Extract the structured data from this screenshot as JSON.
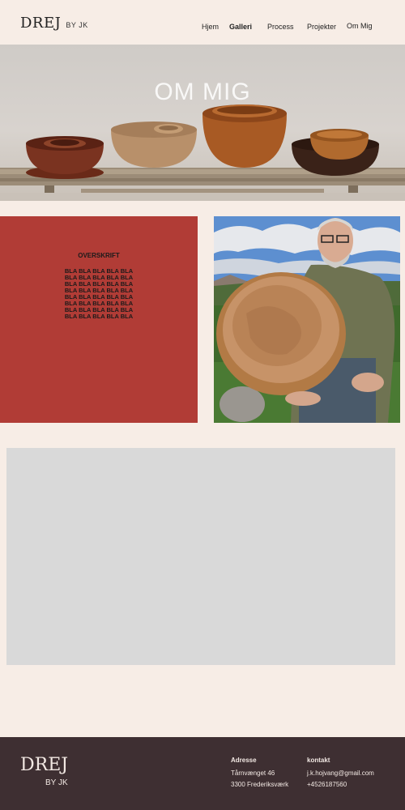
{
  "header": {
    "logo_main": "DREJ",
    "logo_sub": "BY JK",
    "nav": [
      {
        "label": "Hjem"
      },
      {
        "label": "Galleri"
      },
      {
        "label": "Process"
      },
      {
        "label": "Projekter"
      },
      {
        "label": "Om Mig"
      }
    ]
  },
  "hero": {
    "title": "OM MIG"
  },
  "textblock": {
    "heading": "OVERSKRIFT",
    "lines": [
      "BLA BLA BLA BLA BLA",
      "BLA BLA BLA BLA BLA",
      "BLA BLA BLA BLA BLA",
      "BLA BLA BLA BLA BLA",
      "BLA BLA BLA BLA BLA",
      "BLA BLA BLA BLA BLA",
      "BLA BLA BLA BLA BLA",
      "BLA BLA BLA BLA BLA"
    ]
  },
  "footer": {
    "logo_main": "DREJ",
    "logo_sub": "BY JK",
    "address": {
      "heading": "Adresse",
      "line1": "Tårnvænget 46",
      "line2": "3300 Frederiksværk"
    },
    "contact": {
      "heading": "kontakt",
      "email": "j.k.hojvang@gmail.com",
      "phone": "+4526187560"
    }
  },
  "colors": {
    "background": "#f7ede6",
    "accent_red": "#b13c36",
    "footer_bg": "#3e2f32",
    "placeholder_grey": "#d9d9d9"
  }
}
